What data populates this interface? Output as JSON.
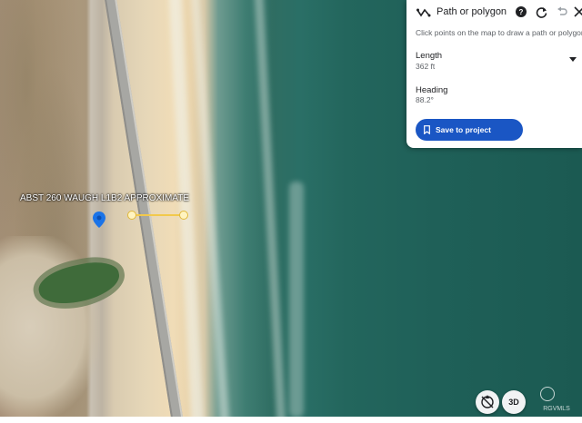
{
  "map": {
    "placemark_label": "ABST 260 WAUGH L1B2 APPROXIMATE"
  },
  "panel": {
    "title": "Path or polygon",
    "hint": "Click points on the map to draw a path or polygon",
    "length_label": "Length",
    "length_value": "362 ft",
    "heading_label": "Heading",
    "heading_value": "88.2°",
    "save_label": "Save to project",
    "icons": [
      "path-icon",
      "help-icon",
      "redo-icon",
      "undo-icon",
      "close-icon",
      "chevron-down-icon"
    ]
  },
  "controls": {
    "three_d_label": "3D"
  },
  "watermark": {
    "text": "RGVMLS"
  },
  "colors": {
    "accent": "#1a56c4",
    "measure_line": "#f2c94c",
    "pin": "#1a73e8"
  }
}
